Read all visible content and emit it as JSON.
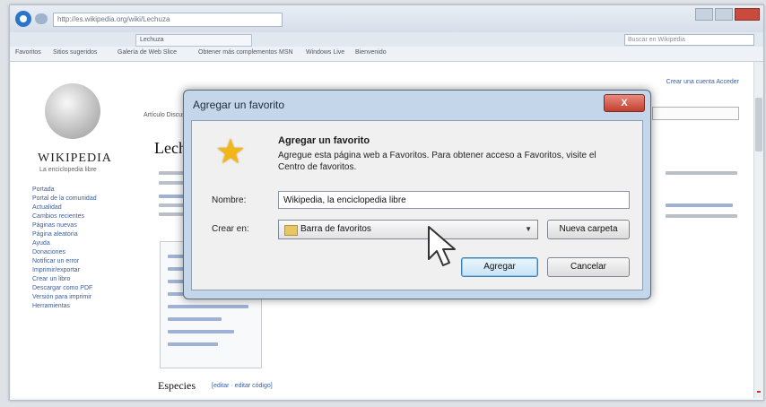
{
  "browser": {
    "address": "http://es.wikipedia.org/wiki/Lechuza",
    "tab": "Lechuza",
    "search_placeholder": "Buscar en Wikipedia",
    "favorites_bar": [
      "Favoritos",
      "Sitios sugeridos",
      "Galería de Web Slice",
      "Obtener más complementos",
      "MSN",
      "Windows Live",
      "Bienvenido"
    ]
  },
  "wiki": {
    "wordmark": "WIKIPEDIA",
    "tagline": "La enciclopedia libre",
    "top_links": "Crear una cuenta  Acceder",
    "page_tabs": "Artículo  Discusión",
    "heading": "Lechuza",
    "section": "Especies",
    "section_links": "[editar · editar código]",
    "sidebar": [
      "Portada",
      "Portal de la comunidad",
      "Actualidad",
      "Cambios recientes",
      "Páginas nuevas",
      "Página aleatoria",
      "Ayuda",
      "Donaciones",
      "Notificar un error",
      "Imprimir/exportar",
      "Crear un libro",
      "Descargar como PDF",
      "Versión para imprimir",
      "Herramientas"
    ]
  },
  "dialog": {
    "title": "Agregar un favorito",
    "close_label": "X",
    "heading": "Agregar un favorito",
    "description": "Agregue esta página web a Favoritos. Para obtener acceso a Favoritos, visite el Centro de favoritos.",
    "name_label": "Nombre:",
    "name_value": "Wikipedia, la enciclopedia libre",
    "create_in_label": "Crear en:",
    "folder_value": "Barra de favoritos",
    "new_folder_button": "Nueva carpeta",
    "add_button": "Agregar",
    "cancel_button": "Cancelar"
  },
  "icons": {
    "star": "favorite-star-icon",
    "folder": "folder-icon",
    "cursor": "mouse-pointer-icon",
    "ie": "internet-explorer-icon"
  },
  "colors": {
    "dialog_frame": "#c4d6ea",
    "close_button": "#c84b3d",
    "star": "#f2b619",
    "link": "#3a5e9e"
  }
}
